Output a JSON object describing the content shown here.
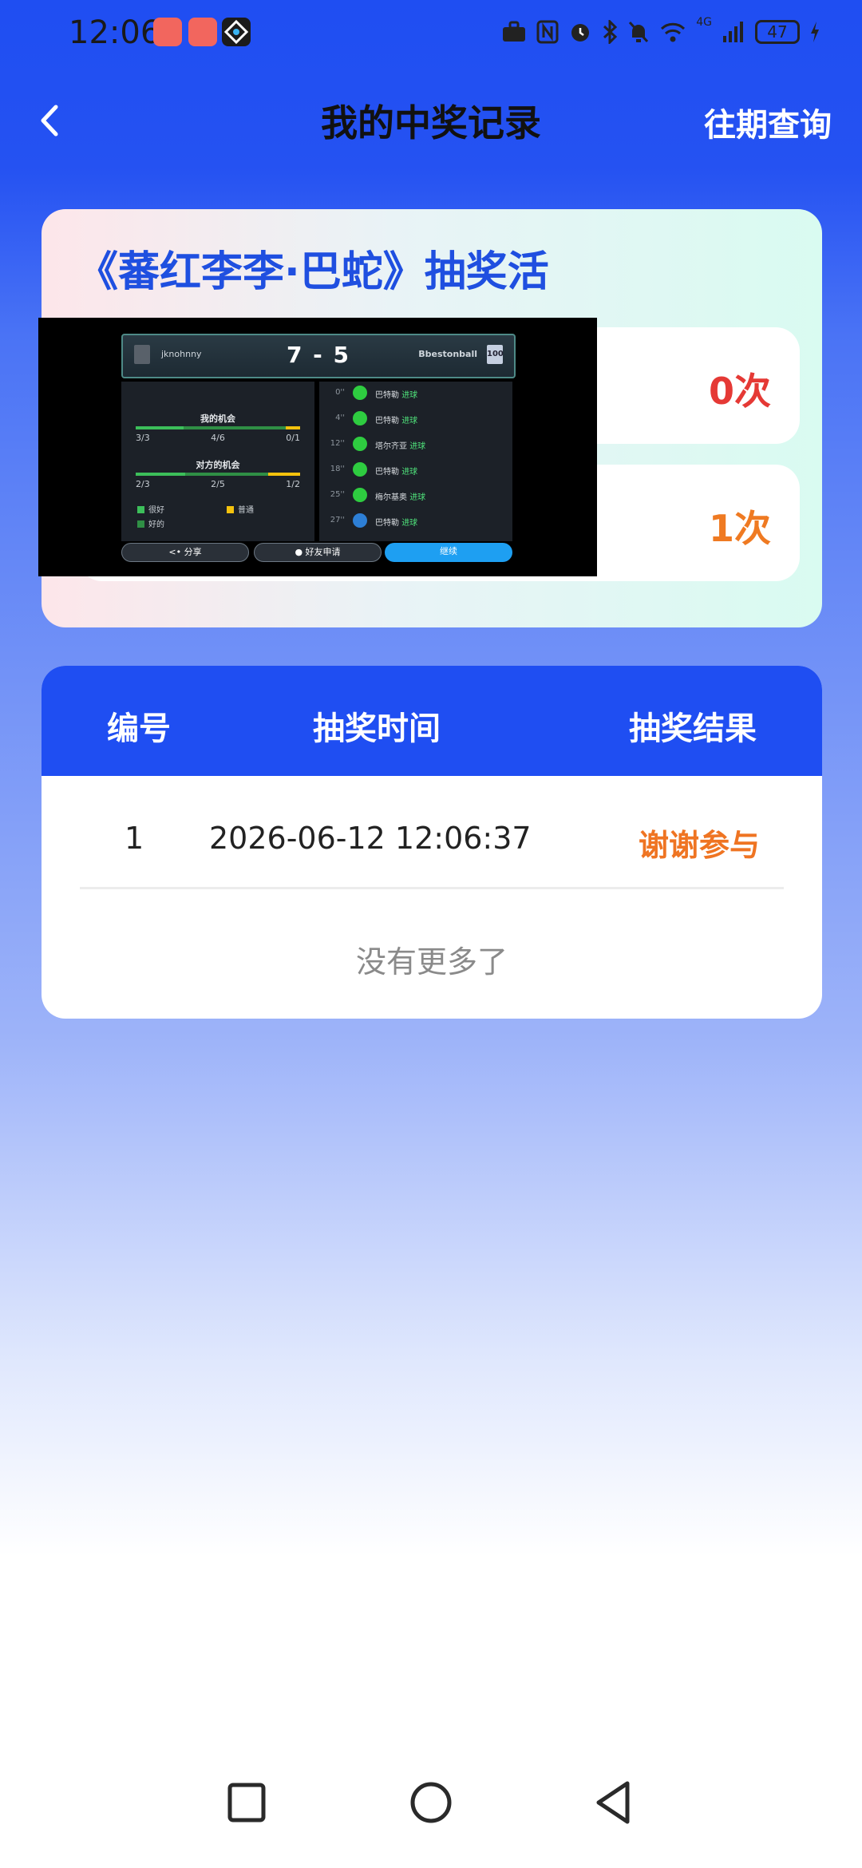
{
  "status_bar": {
    "time": "12:06",
    "notification_icons": [
      "huawei-app-icon",
      "huawei-app-icon",
      "game-app-icon"
    ],
    "battery": "47",
    "network": "4G"
  },
  "header": {
    "title": "我的中奖记录",
    "history_link": "往期查询"
  },
  "activity_card": {
    "title": "《蕃红李李·巴蛇》抽奖活",
    "stats": [
      {
        "value": "0次"
      },
      {
        "value": "1次"
      }
    ]
  },
  "overlay": {
    "player_left": "jknohnny",
    "score": "7 - 5",
    "player_right": "Bbestonball",
    "team_badge": "100",
    "my_chances_label": "我的机会",
    "my_chances": [
      "3/3",
      "4/6",
      "0/1"
    ],
    "opp_chances_label": "对方的机会",
    "opp_chances": [
      "2/3",
      "2/5",
      "1/2"
    ],
    "legend": [
      "很好",
      "普通",
      "好的"
    ],
    "goal_word": "进球",
    "events": [
      {
        "minute": "0''",
        "player": "巴特勒"
      },
      {
        "minute": "4''",
        "player": "巴特勒"
      },
      {
        "minute": "12''",
        "player": "塔尔齐亚"
      },
      {
        "minute": "18''",
        "player": "巴特勒"
      },
      {
        "minute": "25''",
        "player": "梅尔基奥"
      },
      {
        "minute": "27''",
        "player": "巴特勒"
      }
    ],
    "buttons": {
      "share": "分享",
      "friend": "好友申请",
      "continue": "继续"
    }
  },
  "records": {
    "headers": {
      "id": "编号",
      "time": "抽奖时间",
      "result": "抽奖结果"
    },
    "rows": [
      {
        "id": "1",
        "time": "2026-06-12 12:06:37",
        "result": "谢谢参与"
      }
    ],
    "footer": "没有更多了"
  },
  "colors": {
    "primary": "#1f4ef2",
    "stat_red": "#e53935",
    "stat_orange": "#ef7a22",
    "result_orange": "#ef7422"
  }
}
